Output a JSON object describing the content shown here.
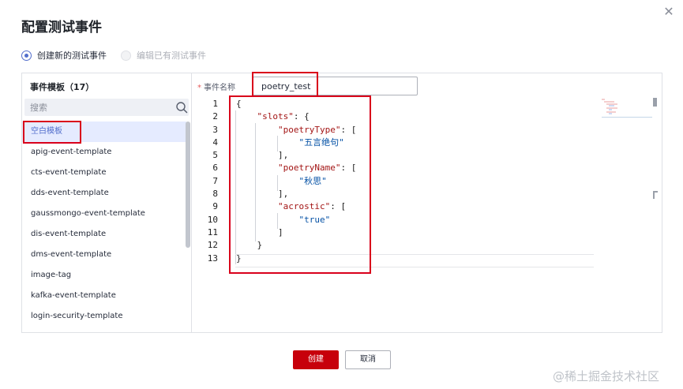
{
  "dialog": {
    "title": "配置测试事件",
    "close_icon": "close-icon"
  },
  "mode": {
    "options": [
      {
        "label": "创建新的测试事件",
        "checked": true,
        "disabled": false
      },
      {
        "label": "编辑已有测试事件",
        "checked": false,
        "disabled": true
      }
    ]
  },
  "sidebar": {
    "title": "事件模板（17）",
    "search_placeholder": "搜索",
    "search_icon": "search-icon",
    "items": [
      {
        "label": "空白模板",
        "active": true
      },
      {
        "label": "apig-event-template",
        "active": false
      },
      {
        "label": "cts-event-template",
        "active": false
      },
      {
        "label": "dds-event-template",
        "active": false
      },
      {
        "label": "gaussmongo-event-template",
        "active": false
      },
      {
        "label": "dis-event-template",
        "active": false
      },
      {
        "label": "dms-event-template",
        "active": false
      },
      {
        "label": "image-tag",
        "active": false
      },
      {
        "label": "kafka-event-template",
        "active": false
      },
      {
        "label": "login-security-template",
        "active": false
      }
    ]
  },
  "event_name": {
    "label": "事件名称",
    "required_mark": "*",
    "value": "poetry_test"
  },
  "editor": {
    "lines": [
      {
        "num": "1",
        "tokens": [
          {
            "t": "{",
            "c": "pun"
          }
        ]
      },
      {
        "num": "2",
        "tokens": [
          {
            "t": "    ",
            "c": "pun"
          },
          {
            "t": "\"slots\"",
            "c": "key"
          },
          {
            "t": ": {",
            "c": "pun"
          }
        ]
      },
      {
        "num": "3",
        "tokens": [
          {
            "t": "        ",
            "c": "pun"
          },
          {
            "t": "\"poetryType\"",
            "c": "key"
          },
          {
            "t": ": [",
            "c": "pun"
          }
        ]
      },
      {
        "num": "4",
        "tokens": [
          {
            "t": "            ",
            "c": "pun"
          },
          {
            "t": "\"五言绝句\"",
            "c": "str"
          }
        ]
      },
      {
        "num": "5",
        "tokens": [
          {
            "t": "        ",
            "c": "pun"
          },
          {
            "t": "],",
            "c": "pun"
          }
        ]
      },
      {
        "num": "6",
        "tokens": [
          {
            "t": "        ",
            "c": "pun"
          },
          {
            "t": "\"poetryName\"",
            "c": "key"
          },
          {
            "t": ": [",
            "c": "pun"
          }
        ]
      },
      {
        "num": "7",
        "tokens": [
          {
            "t": "            ",
            "c": "pun"
          },
          {
            "t": "\"秋思\"",
            "c": "str"
          }
        ]
      },
      {
        "num": "8",
        "tokens": [
          {
            "t": "        ",
            "c": "pun"
          },
          {
            "t": "],",
            "c": "pun"
          }
        ]
      },
      {
        "num": "9",
        "tokens": [
          {
            "t": "        ",
            "c": "pun"
          },
          {
            "t": "\"acrostic\"",
            "c": "key"
          },
          {
            "t": ": [",
            "c": "pun"
          }
        ]
      },
      {
        "num": "10",
        "tokens": [
          {
            "t": "            ",
            "c": "pun"
          },
          {
            "t": "\"true\"",
            "c": "str"
          }
        ]
      },
      {
        "num": "11",
        "tokens": [
          {
            "t": "        ",
            "c": "pun"
          },
          {
            "t": "]",
            "c": "pun"
          }
        ]
      },
      {
        "num": "12",
        "tokens": [
          {
            "t": "    ",
            "c": "pun"
          },
          {
            "t": "}",
            "c": "pun"
          }
        ]
      },
      {
        "num": "13",
        "tokens": [
          {
            "t": "}",
            "c": "pun"
          }
        ]
      }
    ]
  },
  "footer": {
    "create_label": "创建",
    "cancel_label": "取消"
  },
  "watermark": "@稀土掘金技术社区",
  "colors": {
    "primary": "#c7000b",
    "highlight_box": "#d9001b",
    "active_item_bg": "#e5ebff",
    "radio_accent": "#526ecc",
    "json_key": "#a31515",
    "json_string": "#0451a5"
  }
}
